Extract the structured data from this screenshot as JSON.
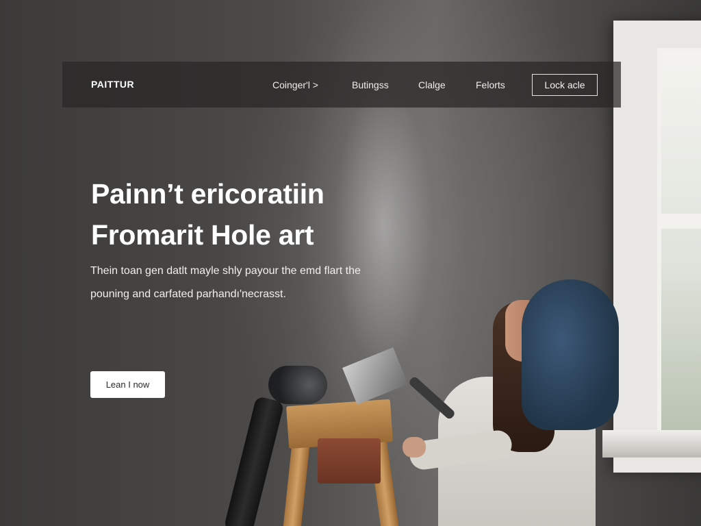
{
  "nav": {
    "brand": "PAITTUR",
    "links": [
      "Coinger'l >",
      "Butingss",
      "Clalge",
      "Felorts"
    ],
    "button_label": "Lock acle"
  },
  "hero": {
    "headline_lines": [
      "Painn’t ericoratiin",
      "Fromarit Hole art"
    ],
    "subtext_lines": [
      "Thein toan gen datlt mayle shly payour the emd flart the",
      "pouning and carfated parhandı'necrasst."
    ],
    "cta_label": "Lean I now"
  },
  "colors": {
    "nav_background": "#282625",
    "text": "#ffffff",
    "cta_background": "#ffffff",
    "cta_text": "#2a2a2a"
  }
}
